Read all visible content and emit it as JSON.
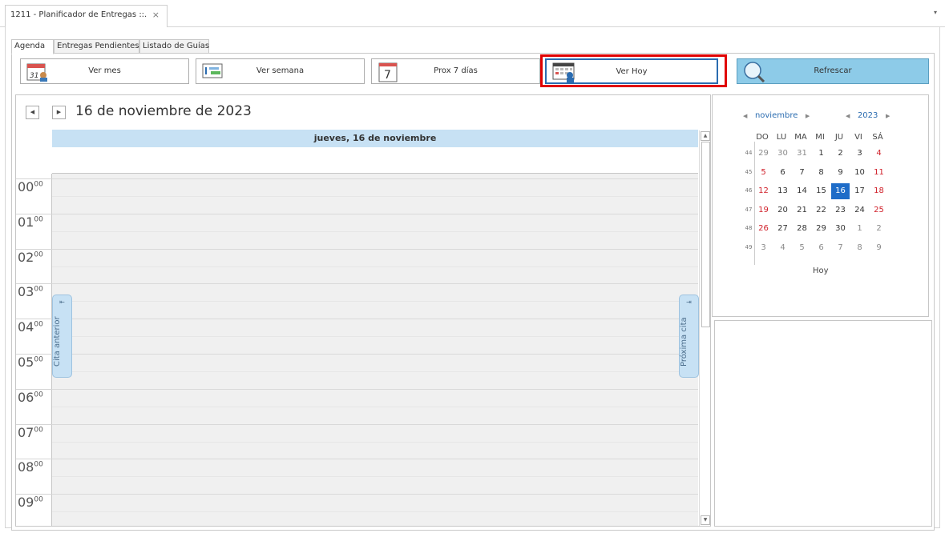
{
  "window": {
    "tab_title": "1211 - Planificador de Entregas ::.",
    "close_glyph": "×",
    "dropdown_glyph": "▾"
  },
  "page_tabs": [
    "Agenda",
    "Entregas Pendientes",
    "Listado de Guías"
  ],
  "toolbar": {
    "ver_mes": "Ver mes",
    "ver_semana": "Ver semana",
    "prox_7": "Prox 7 días",
    "ver_hoy": "Ver Hoy",
    "refrescar": "Refrescar",
    "month_icon_text": "31",
    "week7_icon_text": "7"
  },
  "scheduler": {
    "date_title": "16 de noviembre de 2023",
    "day_header": "jueves, 16 de noviembre",
    "prev_glyph": "◀",
    "next_glyph": "▶",
    "hours": [
      {
        "h": "00",
        "m": "00"
      },
      {
        "h": "01",
        "m": "00"
      },
      {
        "h": "02",
        "m": "00"
      },
      {
        "h": "03",
        "m": "00"
      },
      {
        "h": "04",
        "m": "00"
      },
      {
        "h": "05",
        "m": "00"
      },
      {
        "h": "06",
        "m": "00"
      },
      {
        "h": "07",
        "m": "00"
      },
      {
        "h": "08",
        "m": "00"
      },
      {
        "h": "09",
        "m": "00"
      }
    ],
    "prev_appt": "Cita anterior",
    "next_appt": "Próxima cita",
    "prev_appt_glyph": "⇤",
    "next_appt_glyph": "⇥"
  },
  "calendar": {
    "month": "noviembre",
    "year": "2023",
    "arrow_left": "◀",
    "arrow_right": "▶",
    "weekdays": [
      "DO",
      "LU",
      "MA",
      "MI",
      "JU",
      "VI",
      "SÁ"
    ],
    "weeks": [
      {
        "num": "44",
        "days": [
          "29",
          "30",
          "31",
          "1",
          "2",
          "3",
          "4"
        ]
      },
      {
        "num": "45",
        "days": [
          "5",
          "6",
          "7",
          "8",
          "9",
          "10",
          "11"
        ]
      },
      {
        "num": "46",
        "days": [
          "12",
          "13",
          "14",
          "15",
          "16",
          "17",
          "18"
        ]
      },
      {
        "num": "47",
        "days": [
          "19",
          "20",
          "21",
          "22",
          "23",
          "24",
          "25"
        ]
      },
      {
        "num": "48",
        "days": [
          "26",
          "27",
          "28",
          "29",
          "30",
          "1",
          "2"
        ]
      },
      {
        "num": "49",
        "days": [
          "3",
          "4",
          "5",
          "6",
          "7",
          "8",
          "9"
        ]
      }
    ],
    "today_label": "Hoy",
    "selected_day": "16",
    "colors": {
      "weekend": "#d0202a",
      "selected": "#1e6cc8",
      "accent": "#2b6cb0"
    }
  }
}
